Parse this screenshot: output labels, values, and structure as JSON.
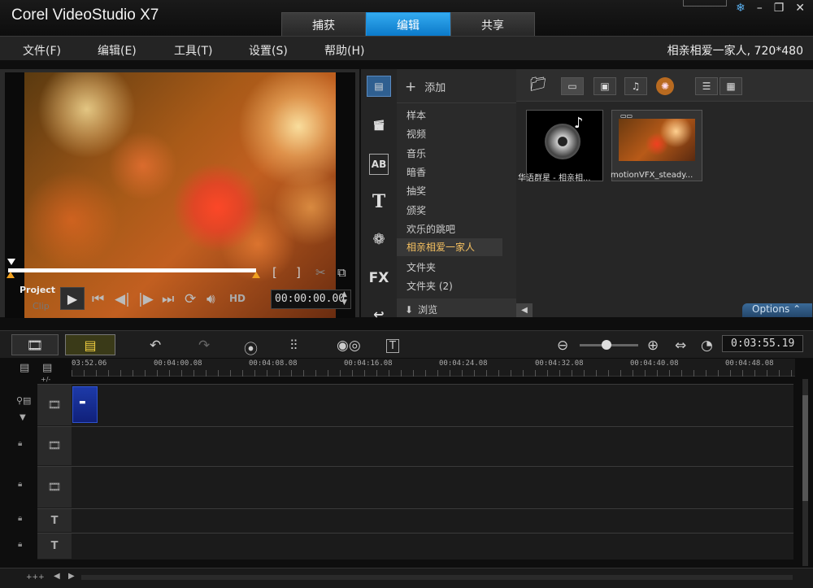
{
  "app": {
    "title": "Corel VideoStudio X7"
  },
  "mode_tabs": [
    "捕获",
    "编辑",
    "共享"
  ],
  "menu": [
    "文件(F)",
    "编辑(E)",
    "工具(T)",
    "设置(S)",
    "帮助(H)"
  ],
  "project_info": "相亲相爱一家人, 720*480",
  "player": {
    "project_label": "Project",
    "clip_label": "Clip",
    "timecode": "00:00:00.00",
    "hd_label": "HD",
    "trim_in": "[",
    "trim_out": "]"
  },
  "library": {
    "add_label": "添加",
    "folders": [
      "样本",
      "视频",
      "音乐",
      "暗香",
      "抽奖",
      "颁奖",
      "欢乐的跳吧",
      "相亲相爱一家人",
      "文件夹",
      "文件夹 (2)"
    ],
    "browse_label": "浏览",
    "thumbs": [
      {
        "label": "华语群星 - 相亲相..."
      },
      {
        "label": "motionVFX_steady..."
      }
    ],
    "options_label": "Options"
  },
  "timeline": {
    "duration": "0:03:55.19",
    "ruler_ticks": [
      "03:52.06",
      "00:04:00.08",
      "00:04:08.08",
      "00:04:16.08",
      "00:04:24.08",
      "00:04:32.08",
      "00:04:40.08",
      "00:04:48.08"
    ],
    "track_add_label": "+/-"
  },
  "colors": {
    "accent": "#0a78c8",
    "selected_folder": "#f5c060",
    "clip": "#1d3aa8",
    "options": "#3a6a98"
  }
}
